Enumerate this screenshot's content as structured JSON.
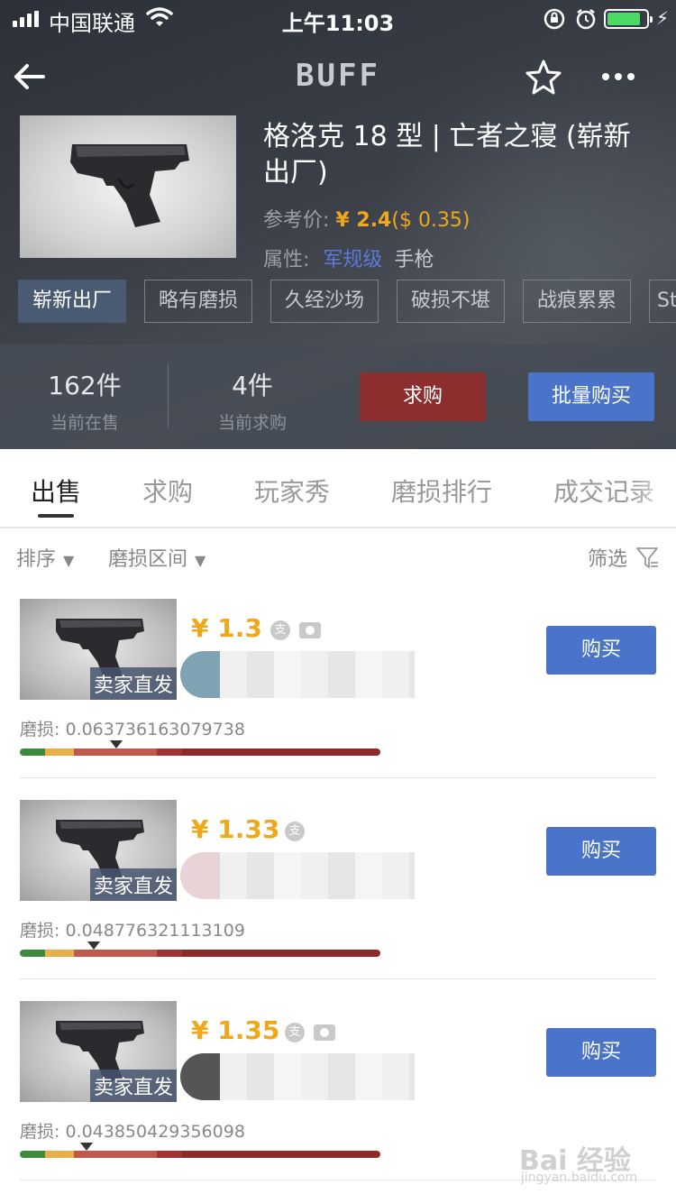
{
  "status_bar": {
    "carrier": "中国联通",
    "time": "上午11:03",
    "battery_level": 0.85
  },
  "header": {
    "logo": "BUFF"
  },
  "item": {
    "title": "格洛克 18 型 | 亡者之寝 (崭新出厂)",
    "ref_price_label": "参考价:",
    "ref_price_cny": "¥ 2.4",
    "ref_price_usd": "($ 0.35)",
    "attrs_label": "属性:",
    "grade": "军规级",
    "weapon_type": "手枪"
  },
  "wear_tabs": [
    "崭新出厂",
    "略有磨损",
    "久经沙场",
    "破损不堪",
    "战痕累累",
    "St"
  ],
  "stats": {
    "on_sale_count": "162件",
    "on_sale_label": "当前在售",
    "wanted_count": "4件",
    "wanted_label": "当前求购",
    "want_button": "求购",
    "bulk_button": "批量购买"
  },
  "tabs": [
    "出售",
    "求购",
    "玩家秀",
    "磨损排行",
    "成交记录"
  ],
  "filters": {
    "sort": "排序",
    "wear_range": "磨损区间",
    "filter": "筛选"
  },
  "listings": [
    {
      "price": "¥ 1.3",
      "tag": "卖家直发",
      "wear_label": "磨损:",
      "wear_value": "0.063736163079738",
      "buy": "购买",
      "wear_float": 0.0637,
      "has_camera": true,
      "avatar_color": "#7fa3b3"
    },
    {
      "price": "¥ 1.33",
      "tag": "卖家直发",
      "wear_label": "磨损:",
      "wear_value": "0.048776321113109",
      "buy": "购买",
      "wear_float": 0.0488,
      "has_camera": false,
      "avatar_color": "#e8d3d6"
    },
    {
      "price": "¥ 1.35",
      "tag": "卖家直发",
      "wear_label": "磨损:",
      "wear_value": "0.043850429356098",
      "buy": "购买",
      "wear_float": 0.0439,
      "has_camera": true,
      "avatar_color": "#555555"
    }
  ],
  "wear_scale": {
    "max": 1.0,
    "segments": [
      {
        "color": "#3d8a3d",
        "end": 0.07
      },
      {
        "color": "#e8b04a",
        "end": 0.15
      },
      {
        "color": "#c0584e",
        "end": 0.38
      },
      {
        "color": "#a33333",
        "end": 0.45
      },
      {
        "color": "#8c2a2a",
        "end": 1.0
      }
    ]
  },
  "watermark": {
    "text": "Bai 经验",
    "sub": "jingyan.baidu.com"
  }
}
